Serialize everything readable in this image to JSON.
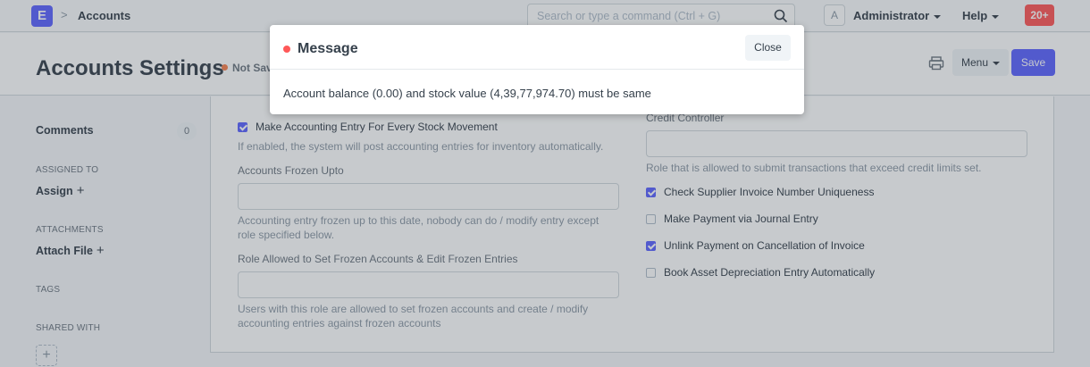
{
  "navbar": {
    "logo_letter": "E",
    "breadcrumb_sep": ">",
    "breadcrumb": "Accounts",
    "search_placeholder": "Search or type a command (Ctrl + G)",
    "avatar_letter": "A",
    "user_label": "Administrator",
    "help_label": "Help",
    "notification_count": "20+"
  },
  "page": {
    "title": "Accounts Settings",
    "status": "Not Saved",
    "menu_label": "Menu",
    "save_label": "Save"
  },
  "sidebar": {
    "comments_label": "Comments",
    "comments_count": "0",
    "assigned_to_label": "ASSIGNED TO",
    "assign_label": "Assign",
    "attachments_label": "ATTACHMENTS",
    "attach_label": "Attach File",
    "tags_label": "TAGS",
    "shared_with_label": "SHARED WITH",
    "plus_glyph": "+"
  },
  "form": {
    "left": {
      "stock_entry_label": "Make Accounting Entry For Every Stock Movement",
      "stock_entry_checked": true,
      "stock_entry_desc": "If enabled, the system will post accounting entries for inventory automatically.",
      "frozen_upto_label": "Accounts Frozen Upto",
      "frozen_upto_value": "",
      "frozen_upto_desc": "Accounting entry frozen up to this date, nobody can do / modify entry except role specified below.",
      "frozen_role_label": "Role Allowed to Set Frozen Accounts & Edit Frozen Entries",
      "frozen_role_value": "",
      "frozen_role_desc": "Users with this role are allowed to set frozen accounts and create / modify accounting entries against frozen accounts"
    },
    "right": {
      "credit_controller_label": "Credit Controller",
      "credit_controller_value": "",
      "credit_controller_desc": "Role that is allowed to submit transactions that exceed credit limits set.",
      "checks": [
        {
          "label": "Check Supplier Invoice Number Uniqueness",
          "checked": true
        },
        {
          "label": "Make Payment via Journal Entry",
          "checked": false
        },
        {
          "label": "Unlink Payment on Cancellation of Invoice",
          "checked": true
        },
        {
          "label": "Book Asset Depreciation Entry Automatically",
          "checked": false
        }
      ]
    }
  },
  "modal": {
    "title": "Message",
    "close_label": "Close",
    "message": "Account balance (0.00) and stock value (4,39,77,974.70) must be same"
  },
  "colors": {
    "primary": "#5e64ff",
    "danger": "#ff5858",
    "warning": "#f8814f"
  }
}
